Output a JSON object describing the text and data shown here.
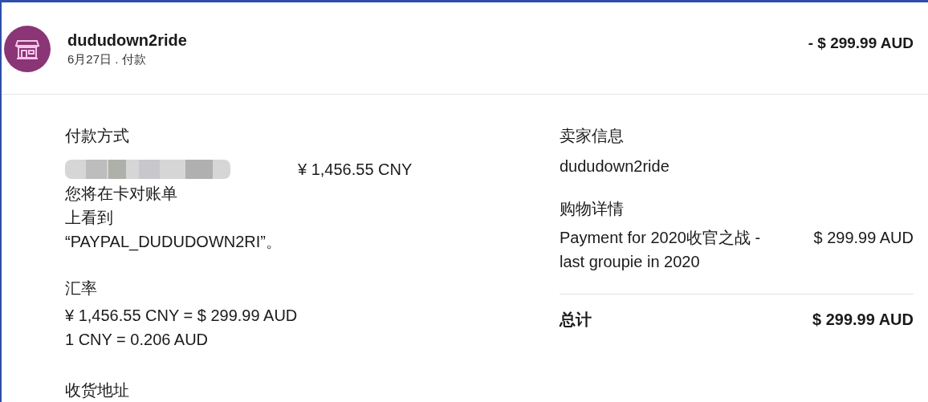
{
  "header": {
    "merchant": "dududown2ride",
    "subtitle": "6月27日 . 付款",
    "amount": "- $ 299.99 AUD"
  },
  "payment": {
    "heading": "付款方式",
    "amount": "¥ 1,456.55 CNY",
    "note_lines": [
      "您将在卡对账单",
      "上看到",
      "“PAYPAL_DUDUDOWN2RI”。"
    ]
  },
  "exchange": {
    "heading": "汇率",
    "lines": [
      "¥ 1,456.55 CNY = $ 299.99 AUD",
      "1 CNY = 0.206 AUD"
    ]
  },
  "shipping": {
    "heading": "收货地址"
  },
  "seller": {
    "heading": "卖家信息",
    "name": "dududown2ride"
  },
  "purchase": {
    "heading": "购物详情",
    "items": [
      {
        "description": "Payment for 2020收官之战 - last groupie in 2020",
        "amount": "$ 299.99 AUD"
      }
    ]
  },
  "total": {
    "label": "总计",
    "amount": "$ 299.99 AUD"
  }
}
